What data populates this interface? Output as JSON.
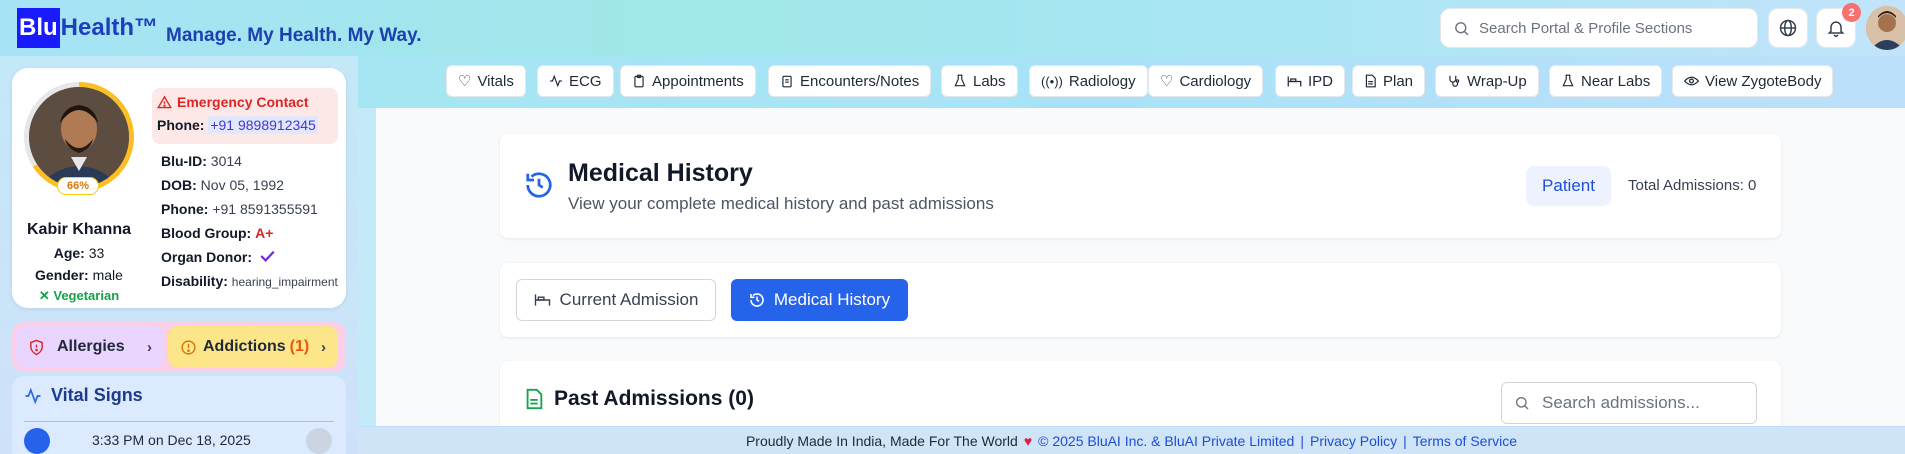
{
  "header": {
    "logo_part1": "Blu",
    "logo_part2": "Health™",
    "tagline": "Manage. My Health. My Way.",
    "search_placeholder": "Search Portal & Profile Sections",
    "notification_count": "2"
  },
  "profile": {
    "completion": "66%",
    "name": "Kabir Khanna",
    "age_label": "Age:",
    "age": "33",
    "gender_label": "Gender:",
    "gender": "male",
    "diet": "Vegetarian",
    "emergency_title": "Emergency Contact",
    "emergency_phone_label": "Phone:",
    "emergency_phone": "+91 9898912345",
    "blu_id_label": "Blu-ID:",
    "blu_id": "3014",
    "dob_label": "DOB:",
    "dob": "Nov 05, 1992",
    "phone_label": "Phone:",
    "phone": "+91 8591355591",
    "blood_group_label": "Blood Group:",
    "blood_group": "A+",
    "organ_donor_label": "Organ Donor:",
    "disability_label": "Disability:",
    "disability": "hearing_impairment"
  },
  "sidebar": {
    "allergies_label": "Allergies",
    "addictions_label": "Addictions",
    "addictions_count": "(1)",
    "vital_title": "Vital Signs",
    "vital_timestamp": "3:33 PM on Dec 18, 2025"
  },
  "nav_tabs": [
    {
      "label": "Vitals",
      "icon": "heart-pulse-icon"
    },
    {
      "label": "ECG",
      "icon": "activity-icon"
    },
    {
      "label": "Appointments",
      "icon": "clipboard-icon"
    },
    {
      "label": "Encounters/Notes",
      "icon": "clipboard-list-icon"
    },
    {
      "label": "Labs",
      "icon": "flask-icon"
    },
    {
      "label": "Radiology",
      "icon": "radio-icon"
    },
    {
      "label": "Cardiology",
      "icon": "heart-pulse-icon"
    },
    {
      "label": "IPD",
      "icon": "bed-icon"
    },
    {
      "label": "Plan",
      "icon": "file-text-icon"
    },
    {
      "label": "Wrap-Up",
      "icon": "stethoscope-icon"
    },
    {
      "label": "Near Labs",
      "icon": "flask-icon"
    },
    {
      "label": "View ZygoteBody",
      "icon": "eye-icon"
    }
  ],
  "medical_history": {
    "title": "Medical History",
    "subtitle": "View your complete medical history and past admissions",
    "patient_label": "Patient",
    "total_admissions": "Total Admissions: 0",
    "current_admission_tab": "Current Admission",
    "medical_history_tab": "Medical History",
    "past_admissions_title": "Past Admissions (0)",
    "search_placeholder": "Search admissions..."
  },
  "footer": {
    "made_in": "Proudly Made In India, Made For The World",
    "copyright": "© 2025 BluAI Inc. & BluAI Private Limited",
    "privacy": "Privacy Policy",
    "terms": "Terms of Service"
  },
  "colors": {
    "brand_blue": "#1a1aff",
    "primary": "#2563eb",
    "emergency": "#dc2626",
    "veg": "#16a34a",
    "completion_ring": "#fbbf24"
  }
}
